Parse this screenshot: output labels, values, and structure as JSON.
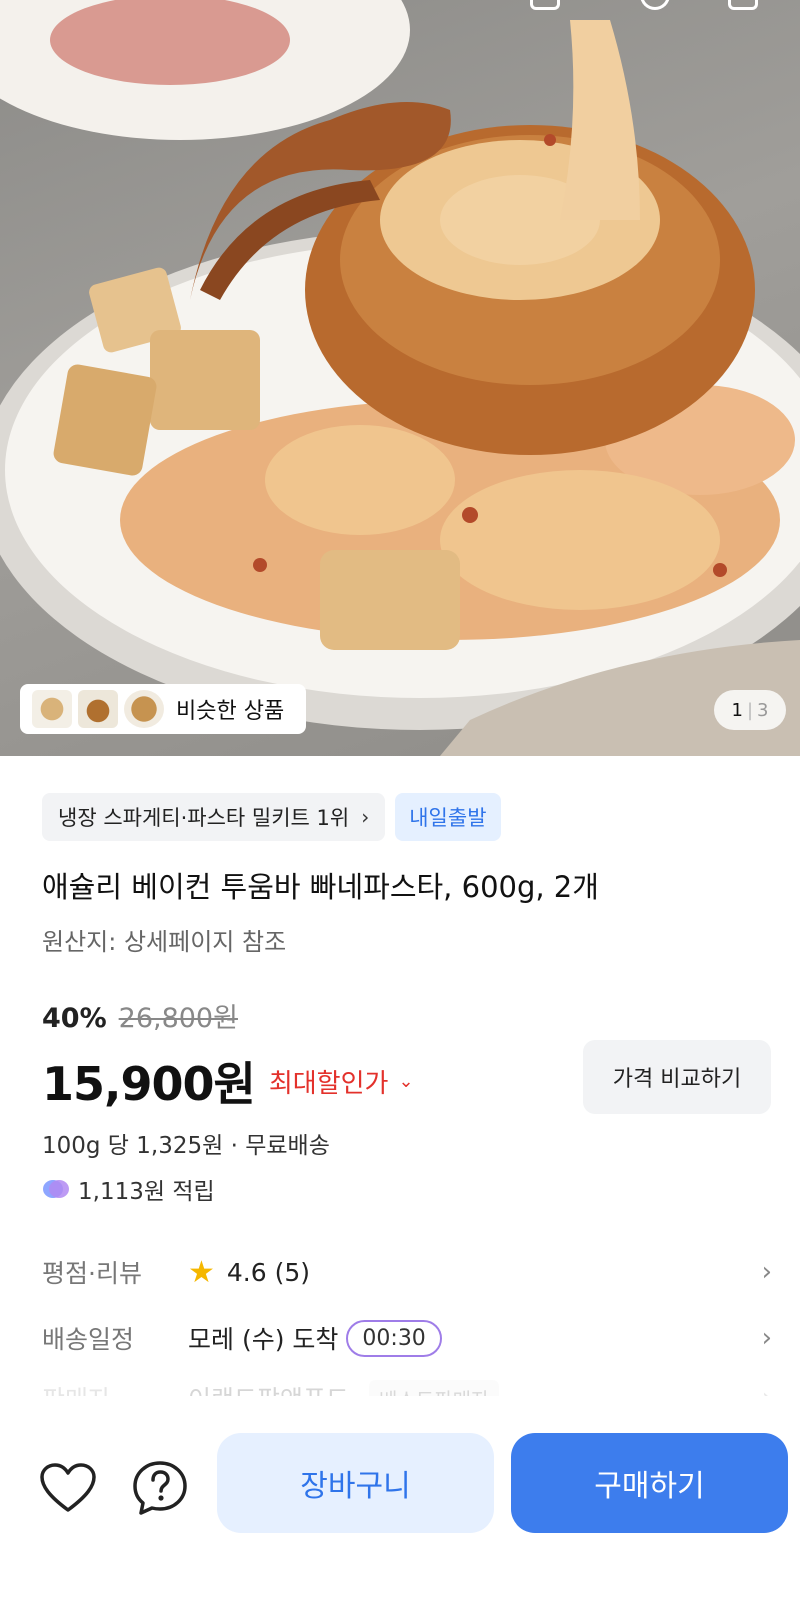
{
  "hero": {
    "image_alt": "pasta bowl photo",
    "similar_label": "비슷한 상품",
    "pager_current": "1",
    "pager_total": "3"
  },
  "tags": {
    "rank": "냉장 스파게티·파스타 밀키트 1위",
    "shipping": "내일출발"
  },
  "product": {
    "title": "애슐리 베이컨 투움바 빠네파스타, 600g, 2개",
    "origin": "원산지: 상세페이지 참조",
    "discount_percent": "40%",
    "original_price": "26,800원",
    "price": "15,900원",
    "max_discount_label": "최대할인가",
    "compare_label": "가격 비교하기",
    "unit_price": "100g 당 1,325원 · 무료배송",
    "points": "1,113원 적립"
  },
  "rows": {
    "review_label": "평점·리뷰",
    "review_value": "4.6 (5)",
    "delivery_label": "배송일정",
    "delivery_value": "모레 (수) 도착",
    "delivery_timer": "00:30",
    "seller_label": "판매자",
    "seller_value": "이랜드팜앤푸드",
    "seller_badge": "베스트판매자"
  },
  "bottom": {
    "cart_label": "장바구니",
    "buy_label": "구매하기"
  },
  "icons": {
    "wishlist": "heart-icon",
    "inquiry": "question-icon",
    "star": "star-icon",
    "chevron": "chevron-right-icon"
  },
  "colors": {
    "accent_blue": "#3d7ded",
    "discount_red": "#e3312b",
    "star_yellow": "#f5b700"
  }
}
